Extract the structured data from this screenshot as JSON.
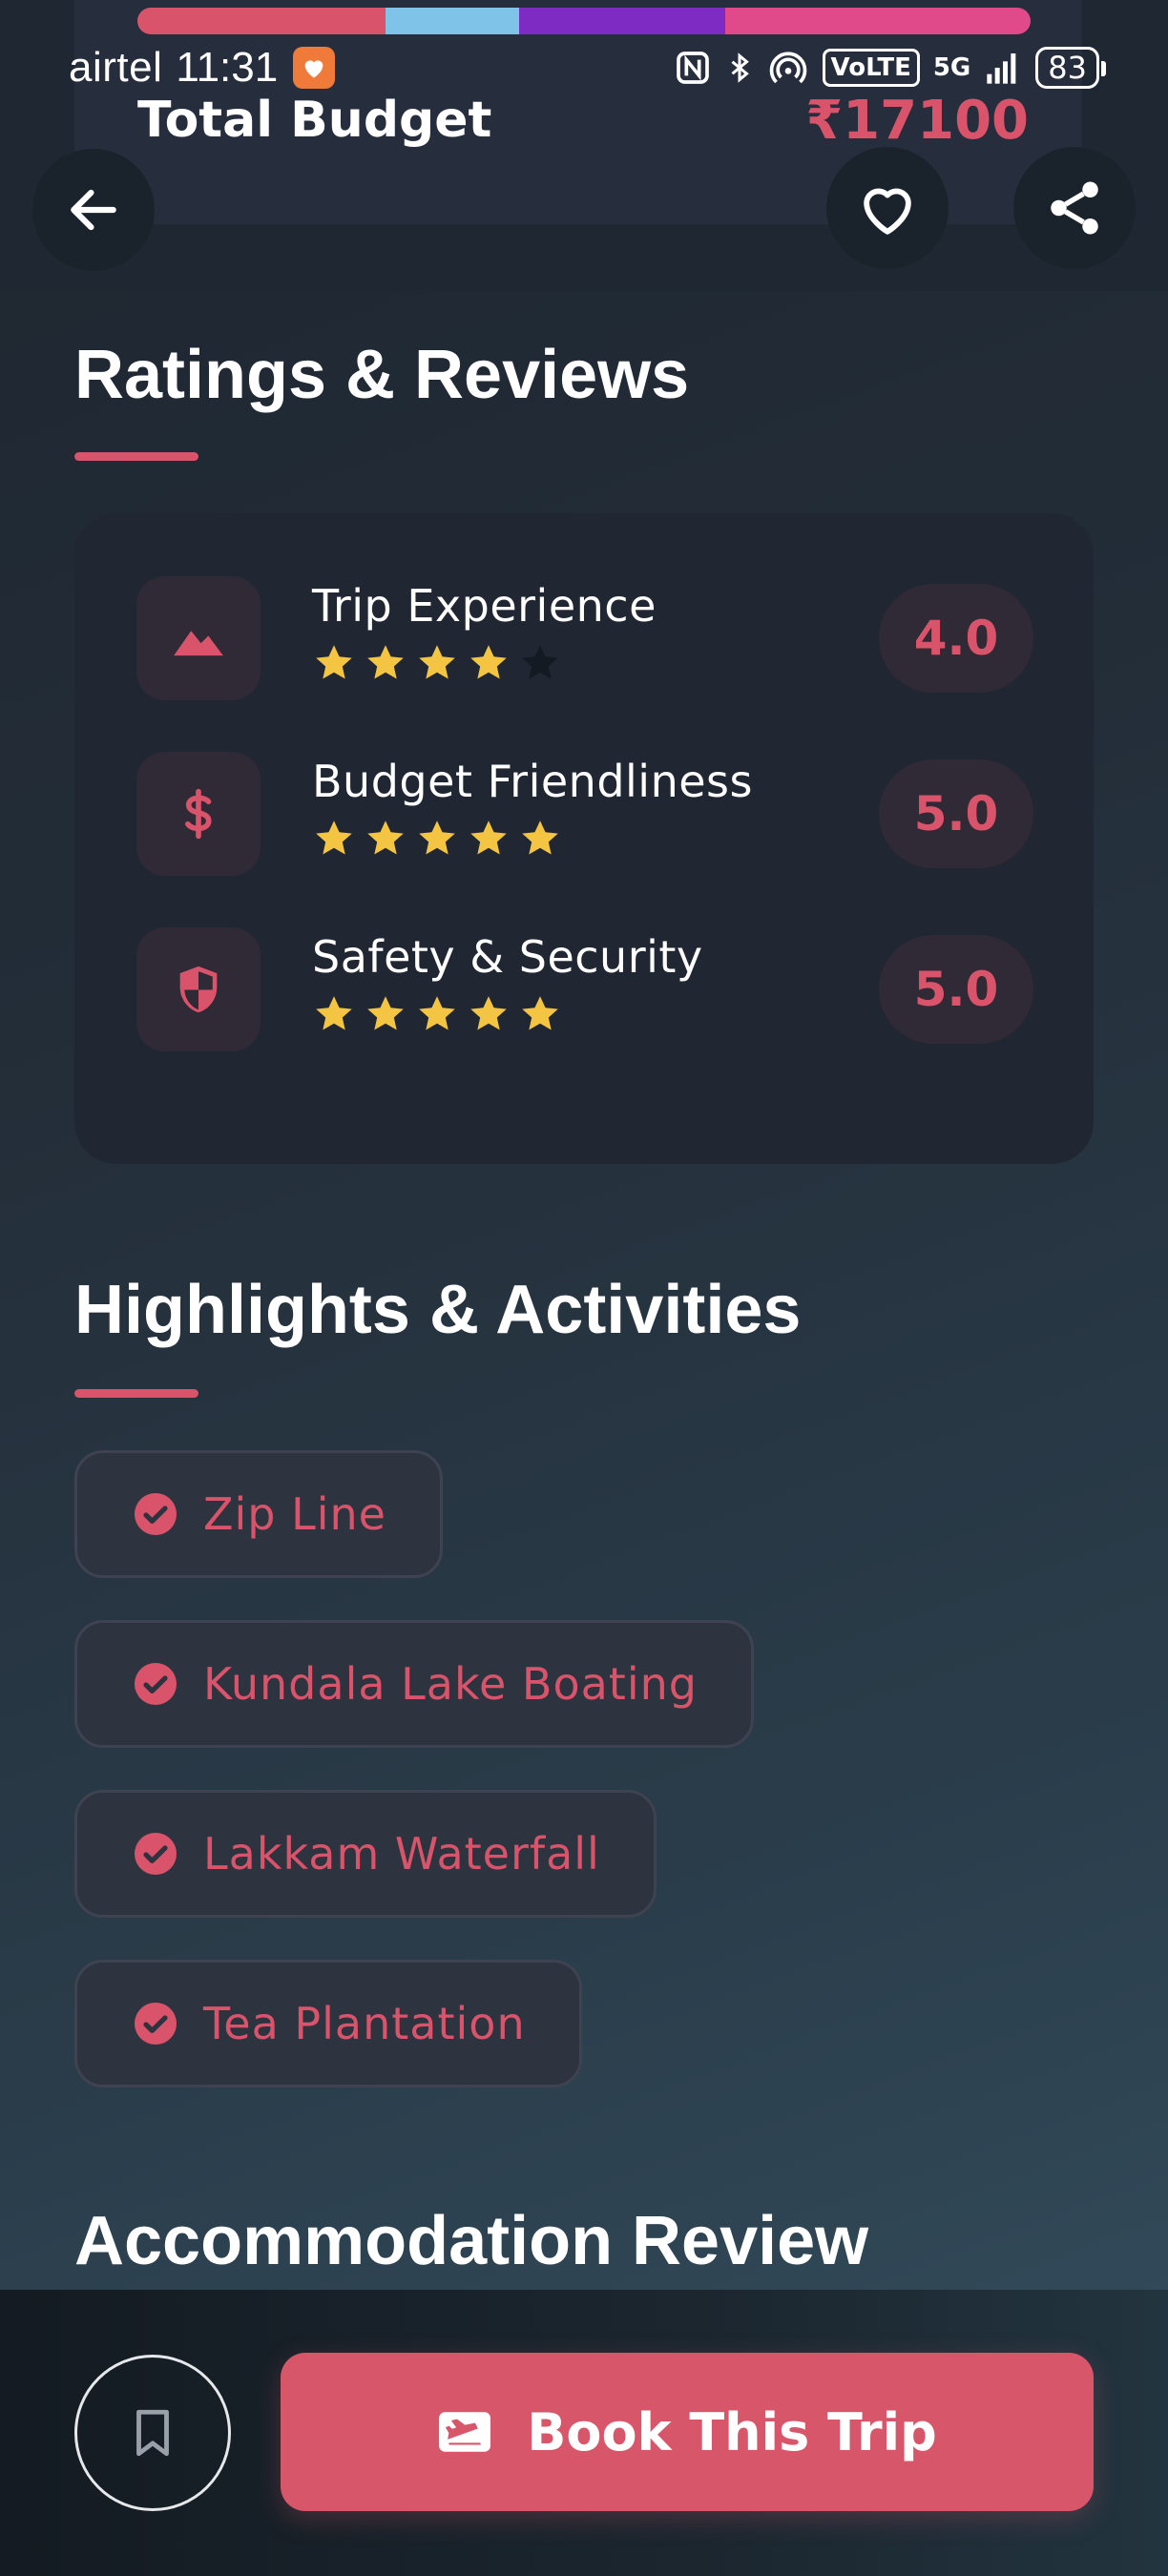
{
  "status_bar": {
    "carrier": "airtel",
    "time": "11:31",
    "network_label": "5G",
    "volte_label": "VoLTE",
    "battery": "83"
  },
  "colorbar_colors": [
    "#d9546a",
    "#7fc3e8",
    "#7d2bc2",
    "#e04a8a"
  ],
  "header": {
    "budget_label": "Total Budget",
    "budget_value": "₹17100"
  },
  "ratings": {
    "title": "Ratings & Reviews",
    "items": [
      {
        "label": "Trip Experience",
        "score": "4.0",
        "stars": 4,
        "icon": "mountain-icon"
      },
      {
        "label": "Budget Friendliness",
        "score": "5.0",
        "stars": 5,
        "icon": "dollar-icon"
      },
      {
        "label": "Safety & Security",
        "score": "5.0",
        "stars": 5,
        "icon": "shield-icon"
      }
    ]
  },
  "highlights": {
    "title": "Highlights & Activities",
    "items": [
      "Zip Line",
      "Kundala Lake Boating",
      "Lakkam Waterfall",
      "Tea Plantation"
    ]
  },
  "accommodation": {
    "title": "Accommodation Review"
  },
  "bottom": {
    "book_label": "Book This Trip"
  },
  "colors": {
    "accent": "#d9546a",
    "star": "#f4c542",
    "star_empty": "#141a22"
  }
}
